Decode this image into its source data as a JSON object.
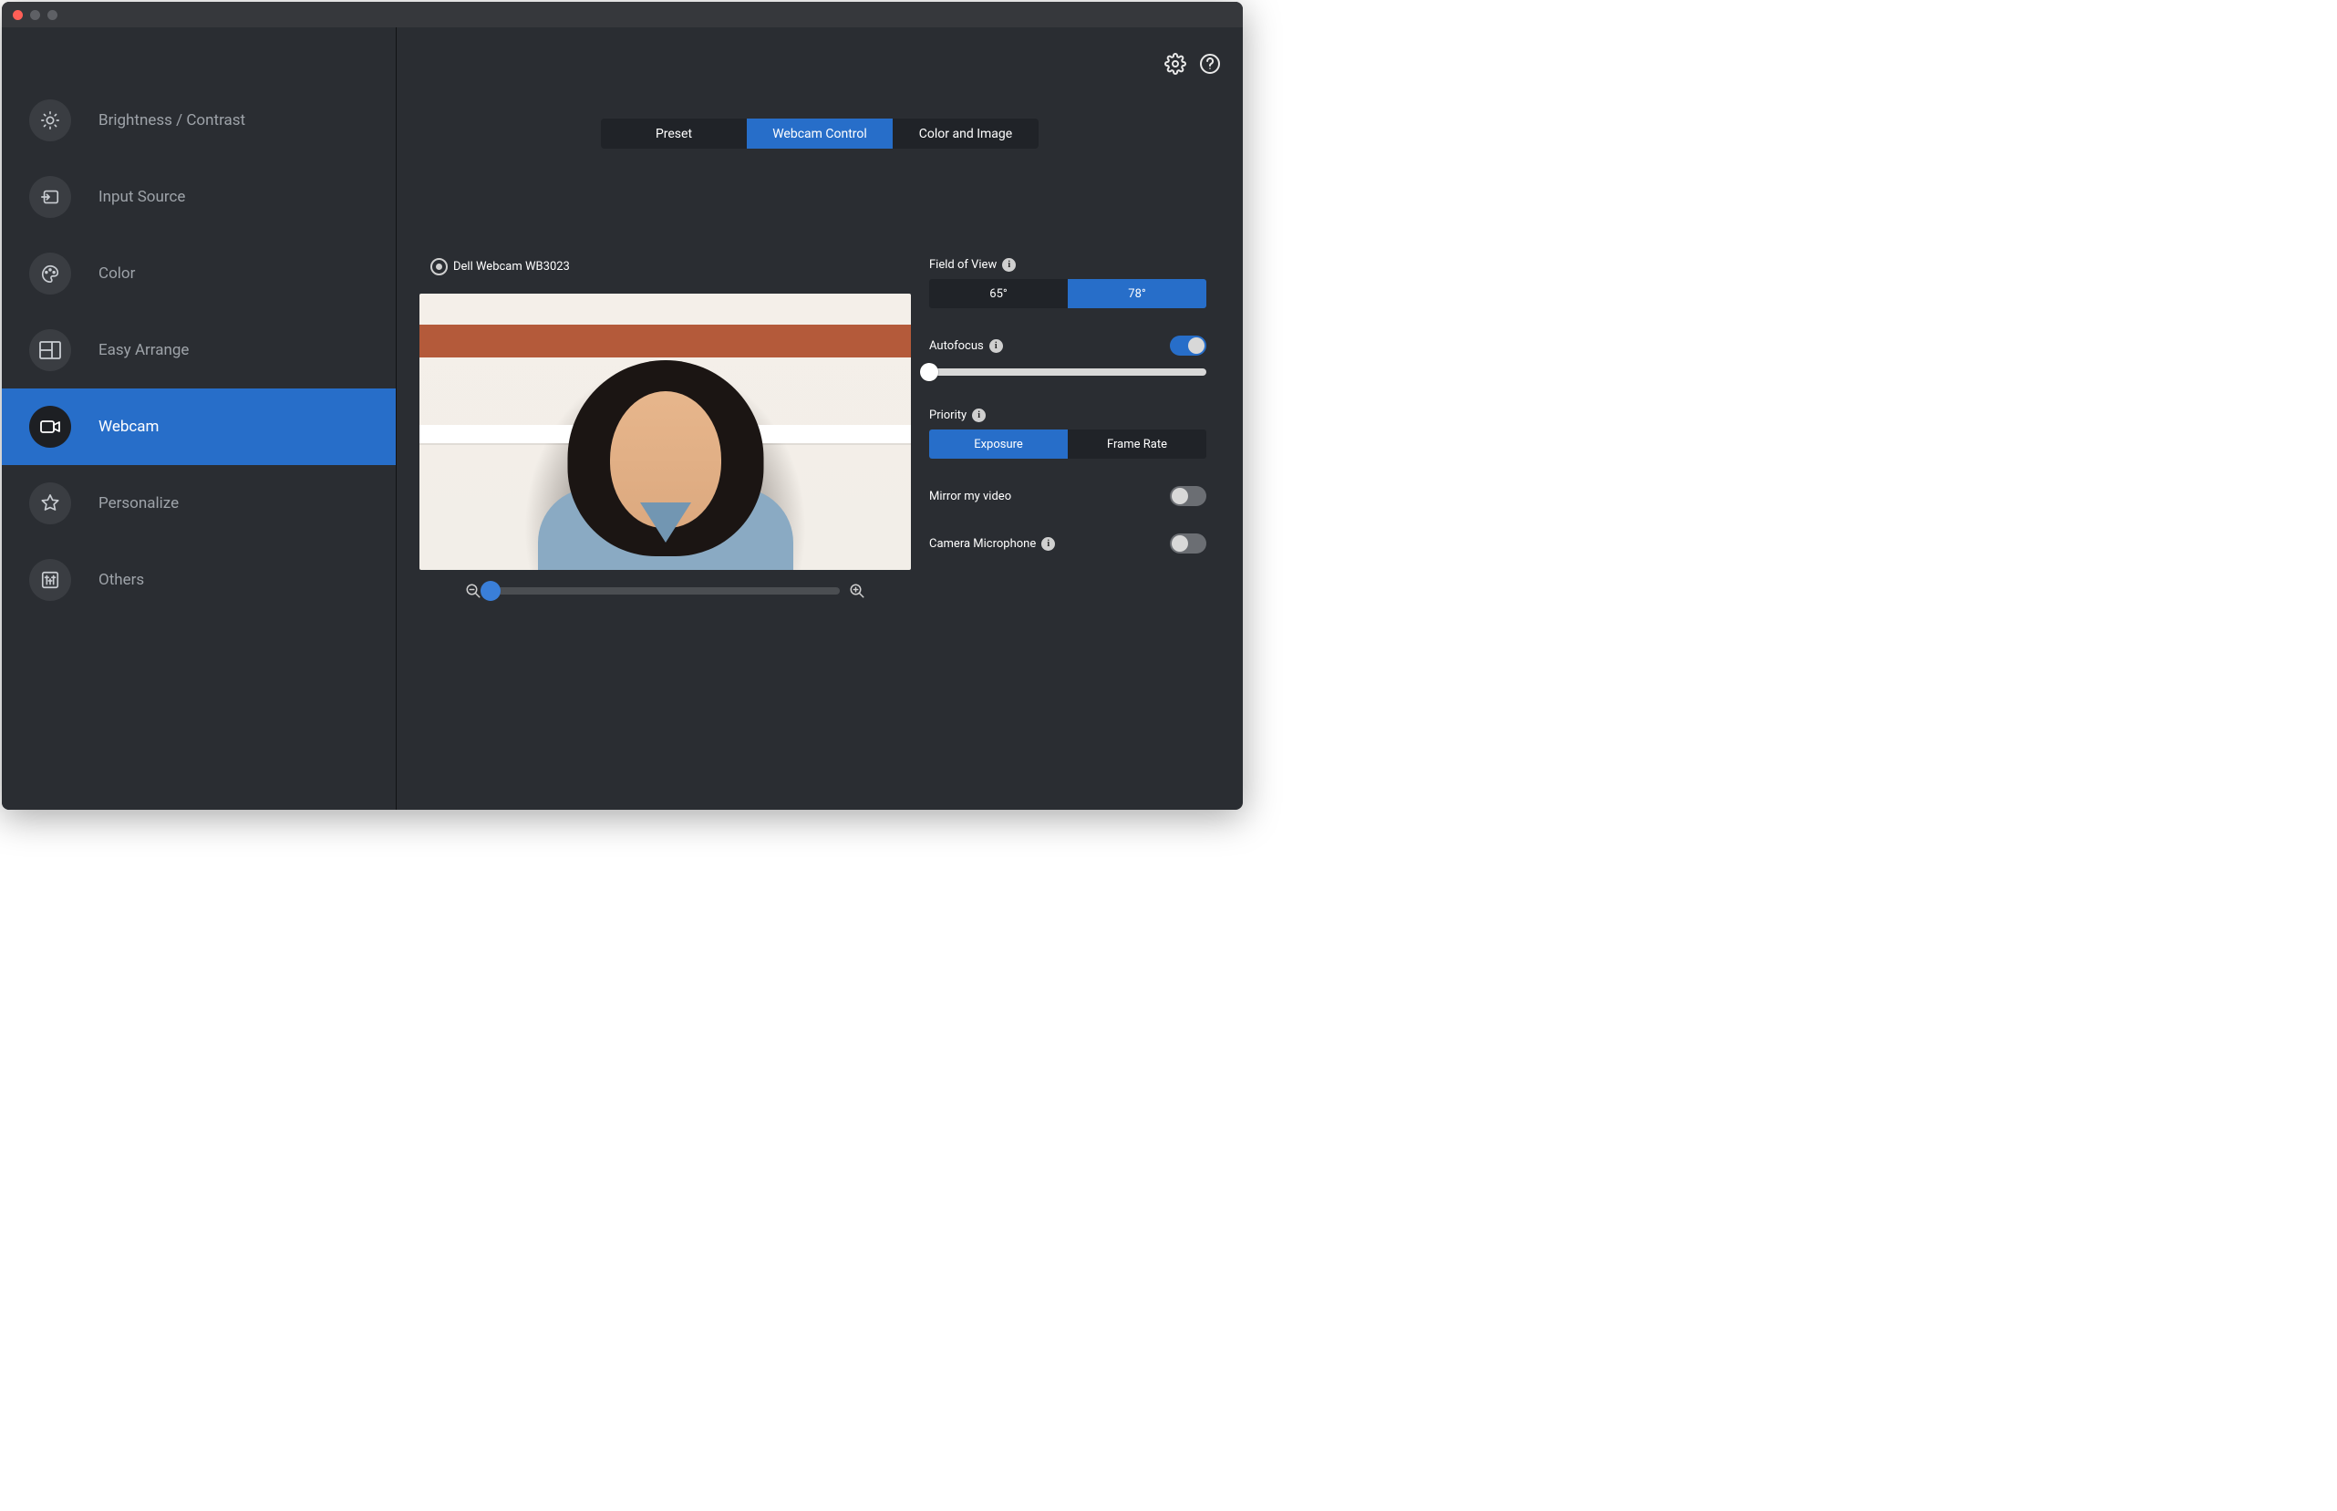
{
  "sidebar": {
    "items": [
      {
        "label": "Brightness / Contrast",
        "icon": "brightness-icon"
      },
      {
        "label": "Input Source",
        "icon": "input-source-icon"
      },
      {
        "label": "Color",
        "icon": "color-icon"
      },
      {
        "label": "Easy Arrange",
        "icon": "easy-arrange-icon"
      },
      {
        "label": "Webcam",
        "icon": "webcam-icon",
        "active": true
      },
      {
        "label": "Personalize",
        "icon": "personalize-icon"
      },
      {
        "label": "Others",
        "icon": "others-icon"
      }
    ]
  },
  "tabs": {
    "items": [
      "Preset",
      "Webcam Control",
      "Color and Image"
    ],
    "active_index": 1
  },
  "camera": {
    "name": "Dell Webcam WB3023",
    "zoom_percent": 0
  },
  "fov": {
    "label": "Field of View",
    "options": [
      "65°",
      "78°"
    ],
    "active_index": 1
  },
  "autofocus": {
    "label": "Autofocus",
    "on": true,
    "slider_percent": 0
  },
  "priority": {
    "label": "Priority",
    "options": [
      "Exposure",
      "Frame Rate"
    ],
    "active_index": 0
  },
  "mirror": {
    "label": "Mirror my video",
    "on": false
  },
  "mic": {
    "label": "Camera Microphone",
    "on": false
  }
}
